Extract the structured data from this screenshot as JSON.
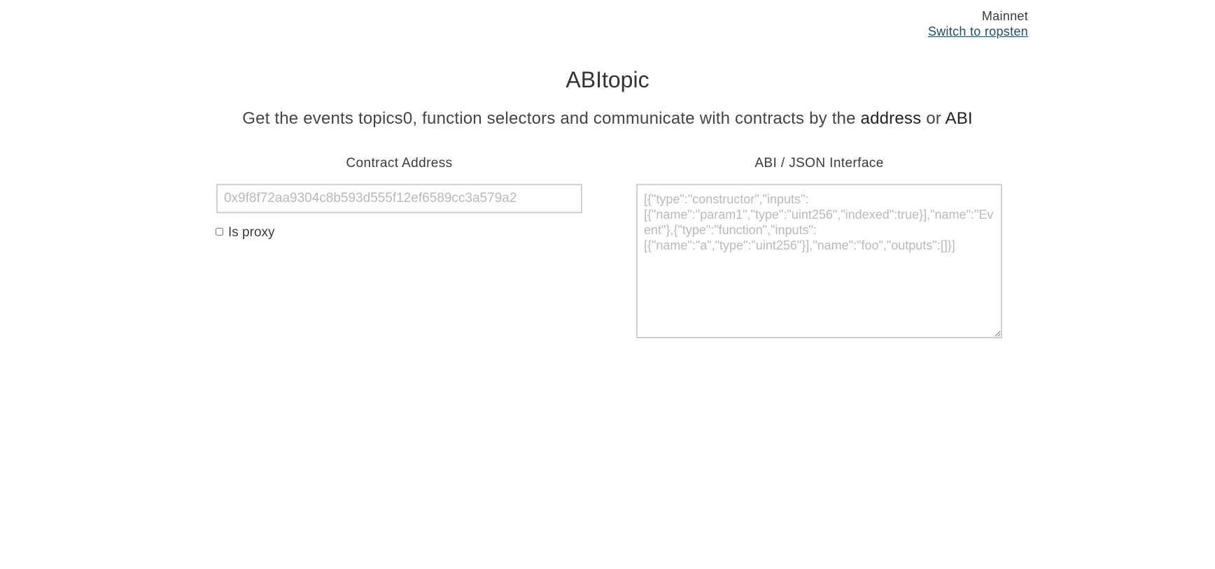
{
  "network": {
    "current": "Mainnet",
    "switch_label": "Switch to ropsten"
  },
  "header": {
    "title": "ABItopic",
    "subtitle_part1": "Get the events topics0, function selectors and communicate with contracts by the ",
    "subtitle_bold1": "address",
    "subtitle_part2": " or ",
    "subtitle_bold2": "ABI"
  },
  "address": {
    "label": "Contract Address",
    "value": "",
    "placeholder": "0x9f8f72aa9304c8b593d555f12ef6589cc3a579a2"
  },
  "proxy": {
    "label": "Is proxy",
    "checked": false
  },
  "abi": {
    "label": "ABI / JSON Interface",
    "value": "",
    "placeholder": "[{\"type\":\"constructor\",\"inputs\":[{\"name\":\"param1\",\"type\":\"uint256\",\"indexed\":true}],\"name\":\"Event\"},{\"type\":\"function\",\"inputs\":[{\"name\":\"a\",\"type\":\"uint256\"}],\"name\":\"foo\",\"outputs\":[]}]"
  }
}
